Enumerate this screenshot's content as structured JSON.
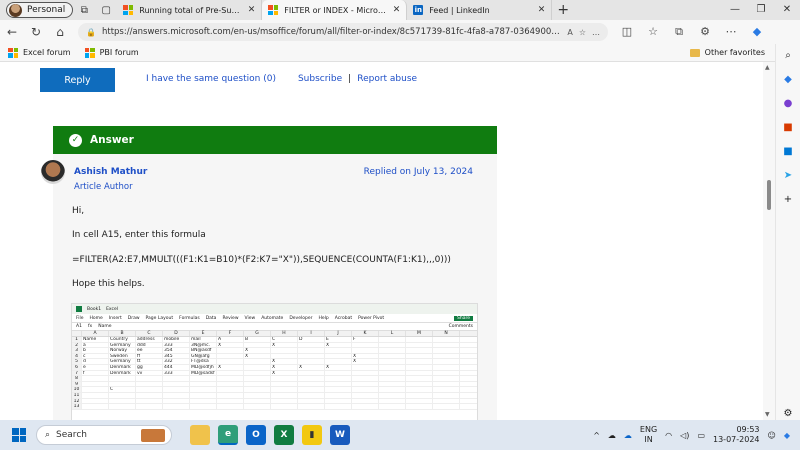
{
  "browser": {
    "profile": "Personal",
    "tabs": [
      {
        "title": "Running total of Pre-Summed Da",
        "icon": "microsoft-icon",
        "active": false
      },
      {
        "title": "FILTER or INDEX - Microsoft Com",
        "icon": "microsoft-icon",
        "active": true
      },
      {
        "title": "Feed | LinkedIn",
        "icon": "linkedin-icon",
        "active": false
      }
    ],
    "url": "https://answers.microsoft.com/en-us/msoffice/forum/all/filter-or-index/8c571739-81fc-4fa8-a787-0364900bdf85?me...",
    "bookmarks": [
      "Excel forum",
      "PBI forum"
    ],
    "other_favorites": "Other favorites"
  },
  "thread": {
    "reply_label": "Reply",
    "same_question": "I have the same question (0)",
    "subscribe": "Subscribe",
    "report": "Report abuse"
  },
  "answer": {
    "header": "Answer",
    "author": "Ashish Mathur",
    "role": "Article Author",
    "replied": "Replied on July 13, 2024",
    "greeting": "Hi,",
    "line1": "In cell A15, enter this formula",
    "formula": "=FILTER(A2:E7,MMULT(((F1:K1=B10)*(F2:K7=\"X\")),SEQUENCE(COUNTA(F1:K1),,,0)))",
    "closing": "Hope this helps."
  },
  "excel": {
    "book": "Book1",
    "app": "Excel",
    "namebox": "A1",
    "formula": "Name",
    "comments": "Comments",
    "share": "Share",
    "ribbon": [
      "File",
      "Home",
      "Insert",
      "Draw",
      "Page Layout",
      "Formulas",
      "Data",
      "Review",
      "View",
      "Automate",
      "Developer",
      "Help",
      "Acrobat",
      "Power Pivot"
    ],
    "columns": [
      "A",
      "B",
      "C",
      "D",
      "E",
      "F",
      "G",
      "H",
      "I",
      "J",
      "K",
      "L",
      "M",
      "N"
    ],
    "rows": [
      [
        "1",
        "Name",
        "Country",
        "address",
        "mobile",
        "mail",
        "A",
        "B",
        "C",
        "D",
        "E",
        "F",
        "",
        "",
        ""
      ],
      [
        "2",
        "a",
        "Germany",
        "ddd",
        "333",
        "3N@mc.",
        "X",
        "",
        "X",
        "",
        "X",
        "",
        "",
        "",
        ""
      ],
      [
        "3",
        "b",
        "Norway",
        "ee",
        "354",
        "BN@asdf",
        "",
        "X",
        "",
        "",
        "",
        "",
        "",
        "",
        ""
      ],
      [
        "4",
        "c",
        "Sweden",
        "ff",
        "345",
        "GN@afg",
        "",
        "X",
        "",
        "",
        "",
        "X",
        "",
        "",
        ""
      ],
      [
        "5",
        "d",
        "Germany",
        "tt",
        "332",
        "FT@dsa",
        "",
        "",
        "X",
        "",
        "",
        "X",
        "",
        "",
        ""
      ],
      [
        "6",
        "e",
        "Denmark",
        "gg",
        "444",
        "MD@sdfjh",
        "X",
        "",
        "X",
        "X",
        "X",
        "",
        "",
        "",
        ""
      ],
      [
        "7",
        "f",
        "Denmark",
        "vv",
        "333",
        "MD@sadsf",
        "",
        "",
        "X",
        "",
        "",
        "",
        "",
        "",
        ""
      ],
      [
        "8",
        "",
        "",
        "",
        "",
        "",
        "",
        "",
        "",
        "",
        "",
        "",
        "",
        "",
        ""
      ],
      [
        "9",
        "",
        "",
        "",
        "",
        "",
        "",
        "",
        "",
        "",
        "",
        "",
        "",
        "",
        ""
      ],
      [
        "10",
        "",
        "C",
        "",
        "",
        "",
        "",
        "",
        "",
        "",
        "",
        "",
        "",
        "",
        ""
      ],
      [
        "11",
        "",
        "",
        "",
        "",
        "",
        "",
        "",
        "",
        "",
        "",
        "",
        "",
        "",
        ""
      ],
      [
        "12",
        "",
        "",
        "",
        "",
        "",
        "",
        "",
        "",
        "",
        "",
        "",
        "",
        "",
        ""
      ],
      [
        "13",
        "",
        "",
        "",
        "",
        "",
        "",
        "",
        "",
        "",
        "",
        "",
        "",
        "",
        ""
      ]
    ]
  },
  "taskbar": {
    "search": "Search",
    "lang1": "ENG",
    "lang2": "IN",
    "time": "09:53",
    "date": "13-07-2024"
  },
  "colors": {
    "answer_green": "#107c10",
    "link_blue": "#1e4fc7",
    "reply_blue": "#0f6cbd"
  }
}
